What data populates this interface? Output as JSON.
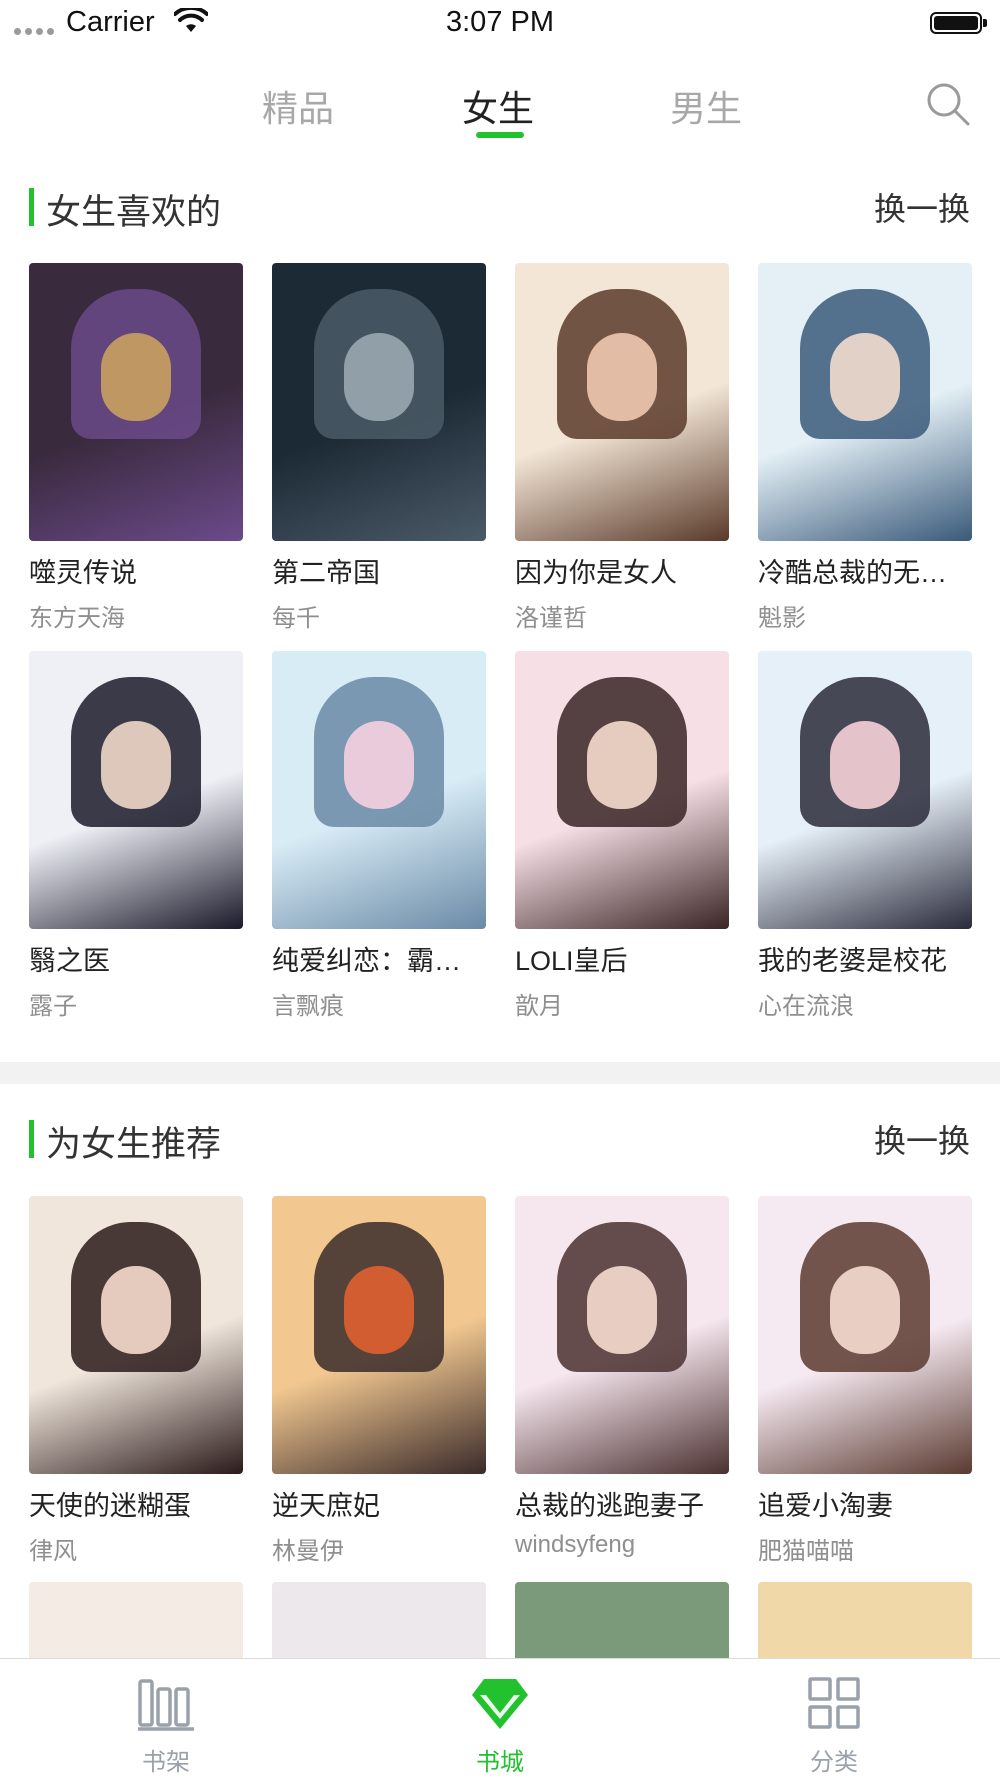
{
  "status_bar": {
    "carrier": "Carrier",
    "time": "3:07 PM"
  },
  "tabs": [
    {
      "label": "精品",
      "active": false
    },
    {
      "label": "女生",
      "active": true
    },
    {
      "label": "男生",
      "active": false
    }
  ],
  "accent_color": "#22c22e",
  "sections": [
    {
      "title": "女生喜欢的",
      "action": "换一换",
      "books": [
        {
          "title": "噬灵传说",
          "author": "东方天海",
          "cover_colors": [
            "#3a2a3e",
            "#6b4a8a",
            "#c8a060"
          ]
        },
        {
          "title": "第二帝国",
          "author": "每千",
          "cover_colors": [
            "#1c2a36",
            "#4a5a66",
            "#9aa8b0"
          ]
        },
        {
          "title": "因为你是女人",
          "author": "洛谨哲",
          "cover_colors": [
            "#f3e6d6",
            "#5a3a2a",
            "#f0c8b0"
          ]
        },
        {
          "title": "冷酷总裁的无情报复",
          "author": "魁影",
          "cover_colors": [
            "#e4f0f6",
            "#3a5a7a",
            "#f2dccc"
          ]
        },
        {
          "title": "翳之医",
          "author": "露子",
          "cover_colors": [
            "#eef0f6",
            "#1a1a2a",
            "#f0d8c8"
          ]
        },
        {
          "title": "纯爱纠恋：霸道女王的温柔爱",
          "author": "言飘痕",
          "cover_colors": [
            "#d8ecf6",
            "#6a8aa6",
            "#f6d0e0"
          ]
        },
        {
          "title": "LOLI皇后",
          "author": "歆月",
          "cover_colors": [
            "#f6e0e6",
            "#3a2424",
            "#f6dccc"
          ]
        },
        {
          "title": "我的老婆是校花",
          "author": "心在流浪",
          "cover_colors": [
            "#e6f0f8",
            "#2a2a3a",
            "#f6d0d8"
          ]
        }
      ]
    },
    {
      "title": "为女生推荐",
      "action": "换一换",
      "books": [
        {
          "title": "天使的迷糊蛋",
          "author": "律风",
          "cover_colors": [
            "#f0e6dc",
            "#2a1a1a",
            "#f6dccc"
          ]
        },
        {
          "title": "逆天庶妃",
          "author": "林曼伊",
          "cover_colors": [
            "#f2c890",
            "#3a2a2a",
            "#e06030"
          ]
        },
        {
          "title": "总裁的逃跑妻子",
          "author": "windsyfeng",
          "cover_colors": [
            "#f6e6ee",
            "#4a3030",
            "#f6dcd0"
          ]
        },
        {
          "title": "追爱小淘妻",
          "author": "肥猫喵喵",
          "cover_colors": [
            "#f6eaf2",
            "#5a3a30",
            "#f6dcd0"
          ]
        }
      ]
    }
  ],
  "partial_covers": [
    "#f4ece4",
    "#ece8ec",
    "#7a9a7a",
    "#f0d8a8"
  ],
  "tab_bar": [
    {
      "label": "书架",
      "icon": "bookshelf-icon",
      "active": false
    },
    {
      "label": "书城",
      "icon": "diamond-icon",
      "active": true
    },
    {
      "label": "分类",
      "icon": "grid-icon",
      "active": false
    }
  ]
}
